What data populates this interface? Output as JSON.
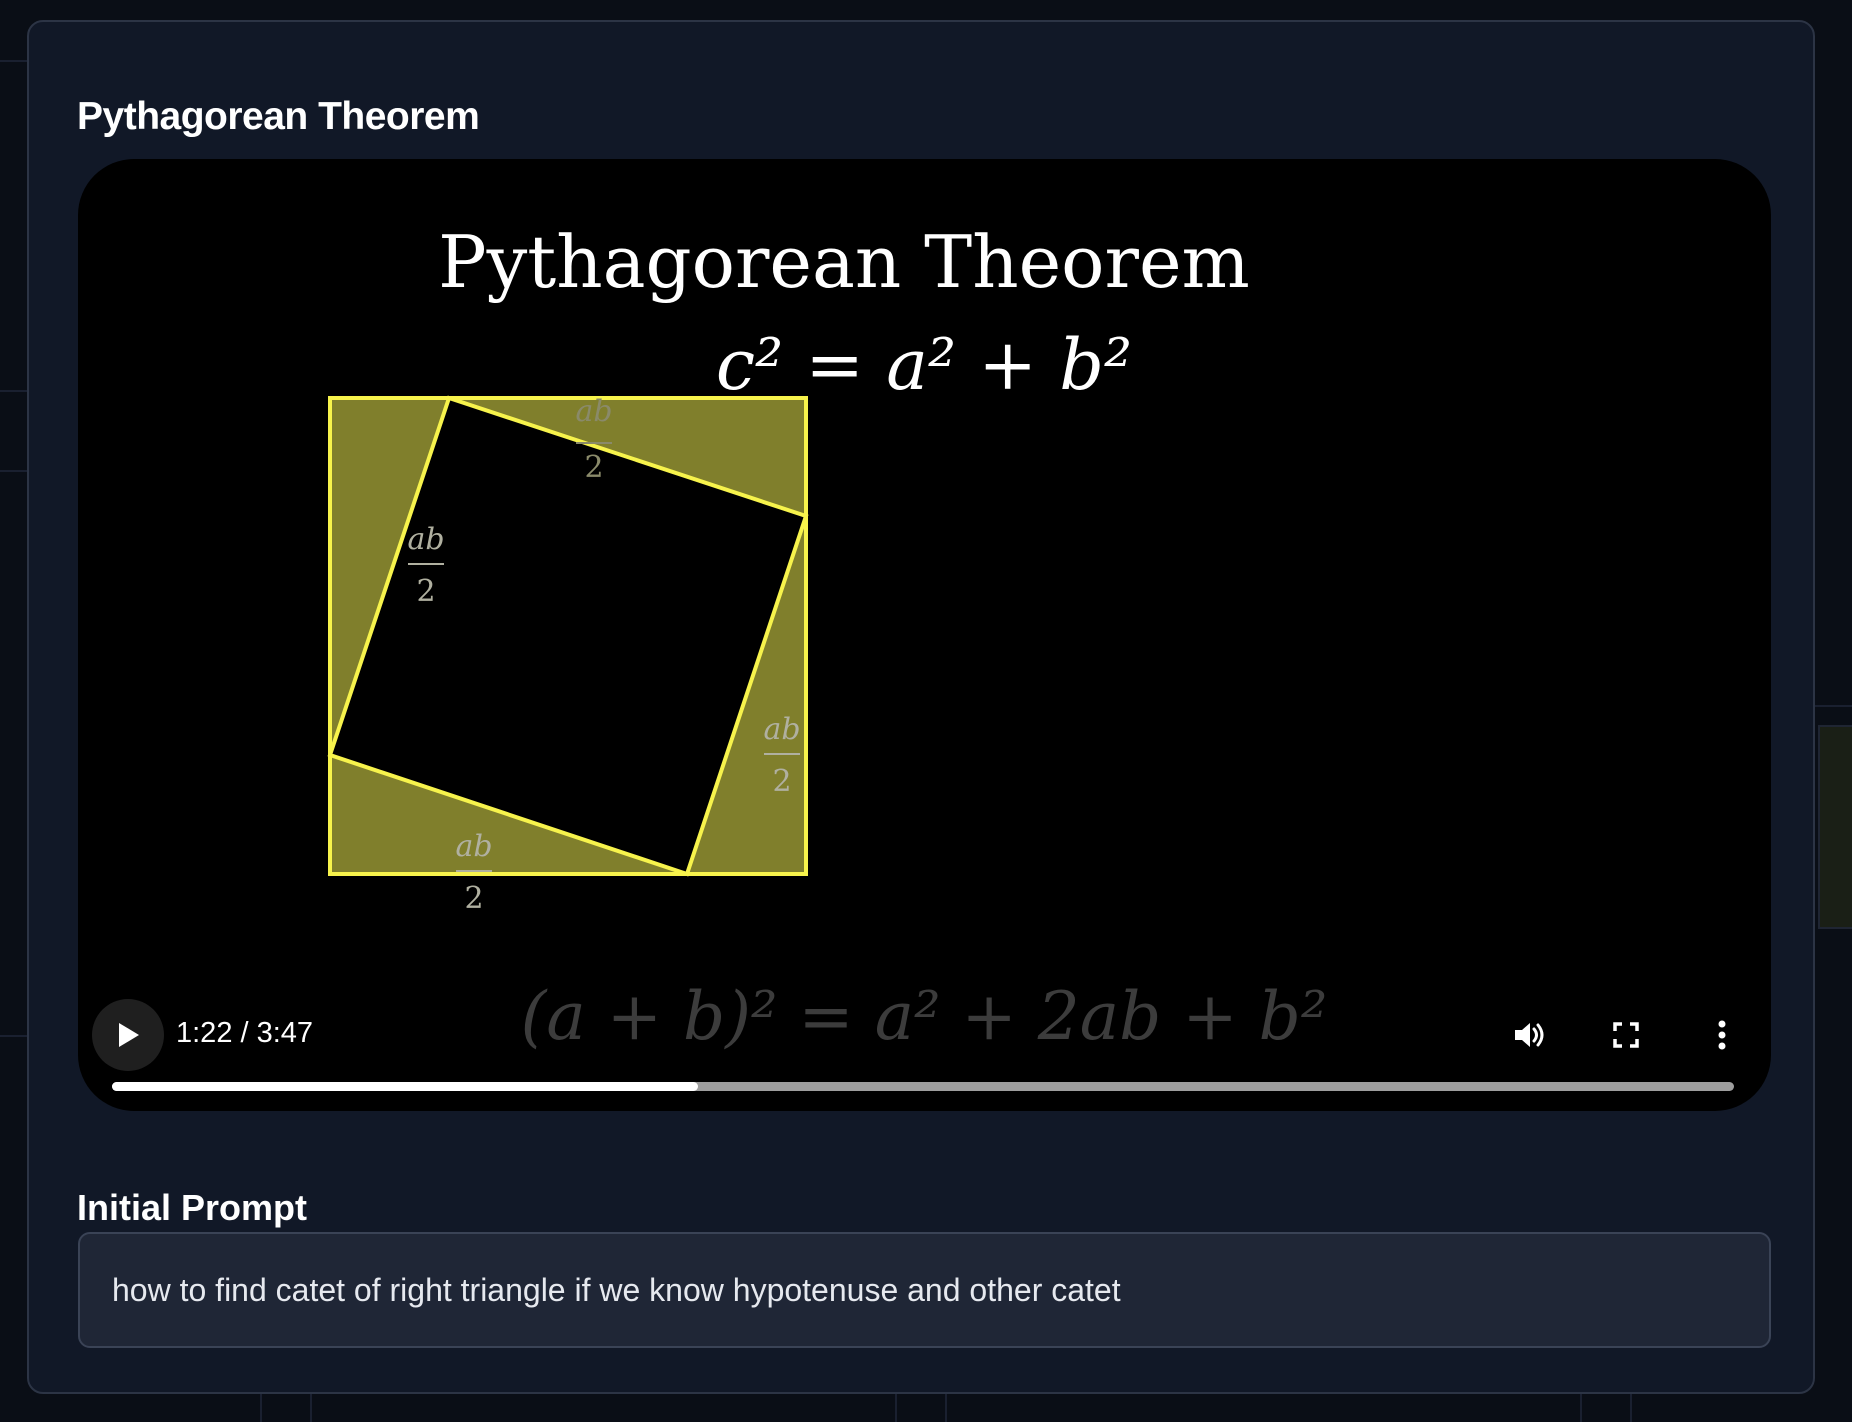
{
  "modal": {
    "title": "Pythagorean Theorem"
  },
  "video": {
    "scene": {
      "heading": "Pythagorean Theorem",
      "formula_main": "c² = a² + b²",
      "formula_expand": "(a + b)² = a² + 2ab + b²",
      "triangle_label_numerator": "ab",
      "triangle_label_denominator": "2",
      "square_fill_color": "#807f2c",
      "square_stroke_color": "#f7f34c"
    },
    "player": {
      "current_time": "1:22",
      "duration": "3:47",
      "time_text": "1:22 / 3:47",
      "progress": 0.361,
      "play_icon": "play-icon",
      "volume_icon": "volume-icon",
      "fullscreen_icon": "fullscreen-icon",
      "more_icon": "more-vertical-icon"
    }
  },
  "prompt": {
    "title": "Initial Prompt",
    "text": "how to find catet of right triangle if we know hypotenuse and other catet"
  }
}
